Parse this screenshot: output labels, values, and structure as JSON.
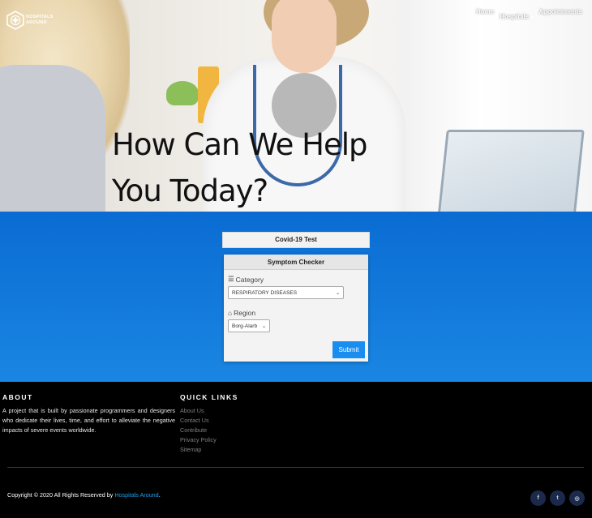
{
  "header": {
    "brand_line1": "HOSPITALS",
    "brand_line2": "AROUND",
    "nav": [
      {
        "label": "Home"
      },
      {
        "label": "Hospitals"
      },
      {
        "label": "Appointments"
      }
    ],
    "hero_title_line1": "How Can We Help",
    "hero_title_line2": "You Today?"
  },
  "main": {
    "covid_button": "Covid-19 Test",
    "card_title": "Symptom Checker",
    "category_label": "Category",
    "category_value": "RESPIRATORY DISEASES",
    "region_label": "Region",
    "region_value": "Borg-Alarb",
    "submit_label": "Submit"
  },
  "footer": {
    "about_heading": "ABOUT",
    "about_text": "A project that is built by passionate programmers and designers who dedicate their lives, time, and effort to alleviate the negative impacts of severe events worldwide.",
    "links_heading": "QUICK LINKS",
    "links": [
      "About Us",
      "Contact Us",
      "Contribute",
      "Privacy Policy",
      "Sitemap"
    ],
    "copyright_prefix": "Copyright © 2020 All Rights Reserved by ",
    "copyright_brand": "Hospitals Around",
    "copyright_suffix": ".",
    "social": [
      {
        "icon": "facebook-icon",
        "glyph": "f"
      },
      {
        "icon": "twitter-icon",
        "glyph": "t"
      },
      {
        "icon": "dribbble-icon",
        "glyph": "◎"
      }
    ]
  },
  "colors": {
    "blue_top": "#0a6cd2",
    "blue_bottom": "#1a86e3",
    "submit": "#1a8ef0",
    "link_accent": "#1ea0e8"
  }
}
